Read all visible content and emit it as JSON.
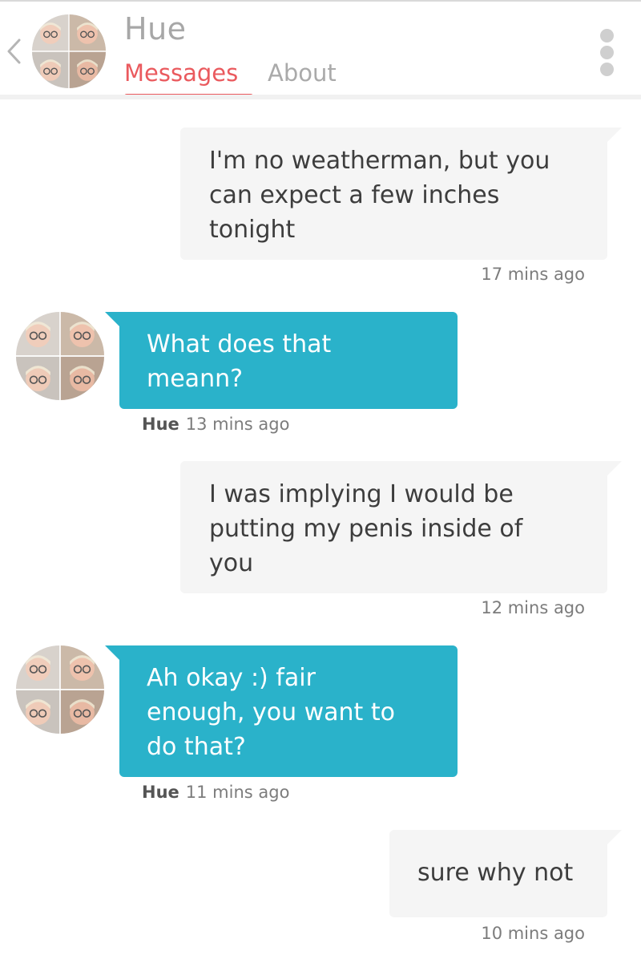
{
  "header": {
    "name": "Hue",
    "tabs": {
      "messages": "Messages",
      "about": "About"
    }
  },
  "colors": {
    "accent": "#ea5a5e",
    "incoming_bubble": "#2ab2ca",
    "outgoing_bubble": "#f5f5f5"
  },
  "icons": {
    "back": "chevron-left-icon",
    "menu": "more-vertical-icon"
  },
  "messages": [
    {
      "direction": "outgoing",
      "text_lines": [
        "I'm no weatherman, but you",
        "can expect a few inches",
        "tonight"
      ],
      "time": "17 mins ago"
    },
    {
      "direction": "incoming",
      "sender": "Hue",
      "text_lines": [
        "What does that",
        "meann?"
      ],
      "time": "13 mins ago"
    },
    {
      "direction": "outgoing",
      "text_lines": [
        "I was implying I would be",
        "putting my penis inside of",
        "you"
      ],
      "time": "12 mins ago"
    },
    {
      "direction": "incoming",
      "sender": "Hue",
      "text_lines": [
        "Ah okay :) fair",
        "enough, you want to",
        "do that?"
      ],
      "time": "11 mins ago"
    },
    {
      "direction": "outgoing",
      "text_lines": [
        "sure why not"
      ],
      "time": "10 mins ago"
    }
  ]
}
